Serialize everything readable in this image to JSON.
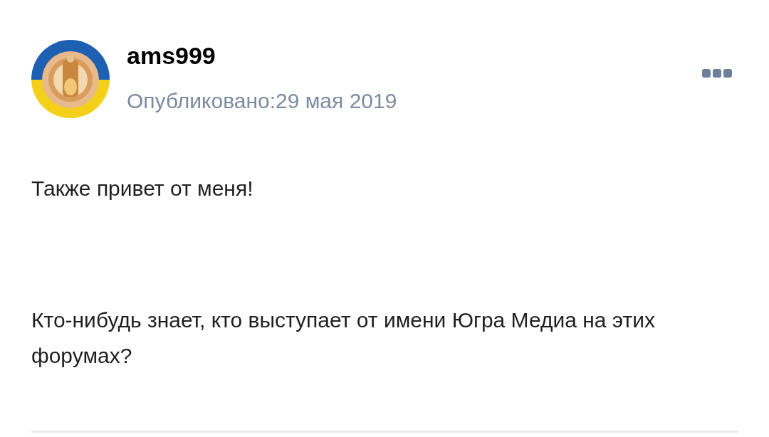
{
  "post": {
    "author": "ams999",
    "published": "Опубликовано:29 мая 2019",
    "paragraphs": [
      "Также привет от меня!",
      "Кто-нибудь знает, кто выступает от имени Югра Медиа на этих форумах?"
    ]
  }
}
